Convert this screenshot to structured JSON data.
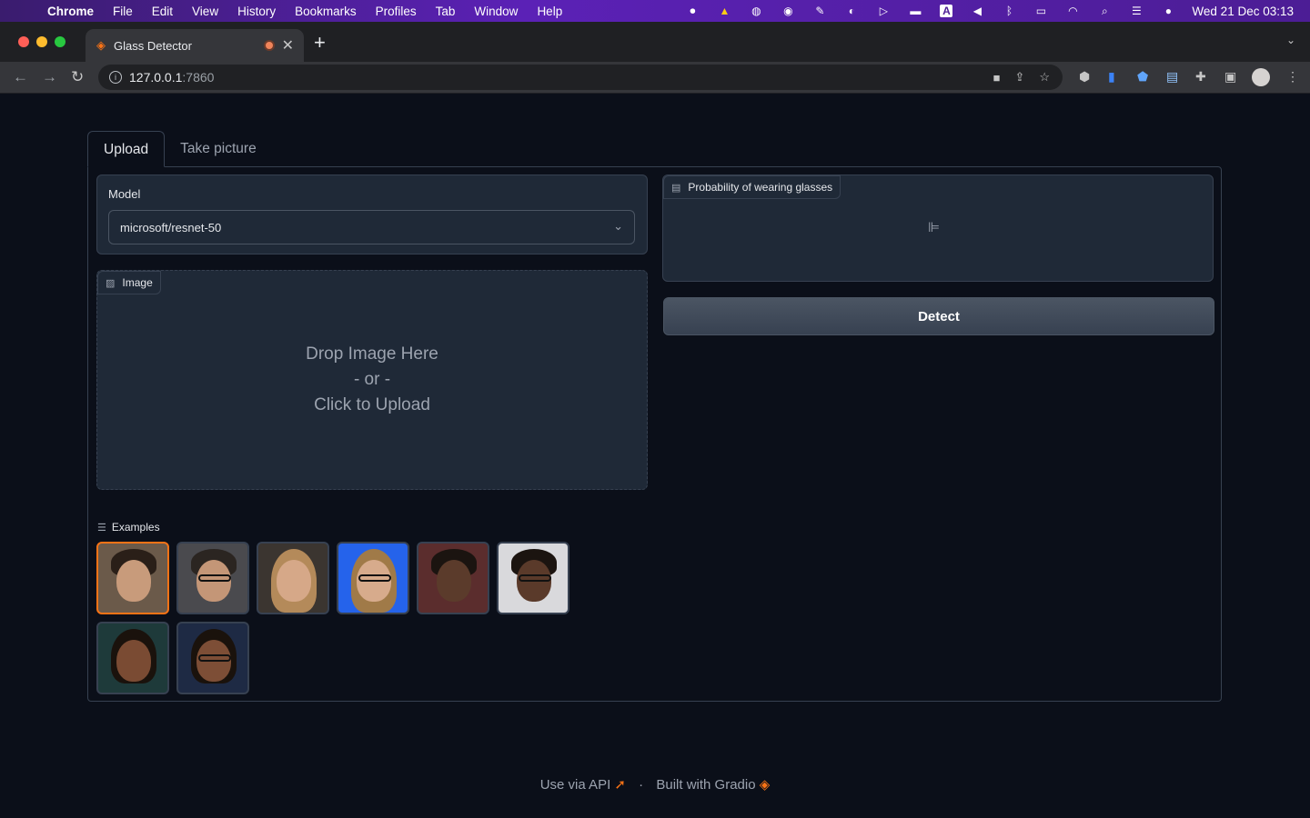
{
  "menubar": {
    "app": "Chrome",
    "items": [
      "File",
      "Edit",
      "View",
      "History",
      "Bookmarks",
      "Profiles",
      "Tab",
      "Window",
      "Help"
    ],
    "clock": "Wed 21 Dec  03:13",
    "letter_icon": "A"
  },
  "browser": {
    "tab_title": "Glass Detector",
    "url_host": "127.0.0.1",
    "url_port": ":7860"
  },
  "app": {
    "tabs": [
      "Upload",
      "Take picture"
    ],
    "model_label": "Model",
    "model_value": "microsoft/resnet-50",
    "image_label": "Image",
    "drop_line1": "Drop Image Here",
    "drop_line2": "- or -",
    "drop_line3": "Click to Upload",
    "output_label": "Probability of wearing glasses",
    "detect_label": "Detect",
    "examples_label": "Examples",
    "examples": [
      {
        "name": "example-1",
        "selected": true
      },
      {
        "name": "example-2",
        "selected": false
      },
      {
        "name": "example-3",
        "selected": false
      },
      {
        "name": "example-4",
        "selected": false
      },
      {
        "name": "example-5",
        "selected": false
      },
      {
        "name": "example-6",
        "selected": false
      },
      {
        "name": "example-7",
        "selected": false
      },
      {
        "name": "example-8",
        "selected": false
      }
    ]
  },
  "footer": {
    "api": "Use via API",
    "sep": "·",
    "built": "Built with Gradio"
  },
  "colors": {
    "accent": "#f97316",
    "background": "#0b0f19",
    "panel": "#1f2937",
    "border": "#374151"
  }
}
